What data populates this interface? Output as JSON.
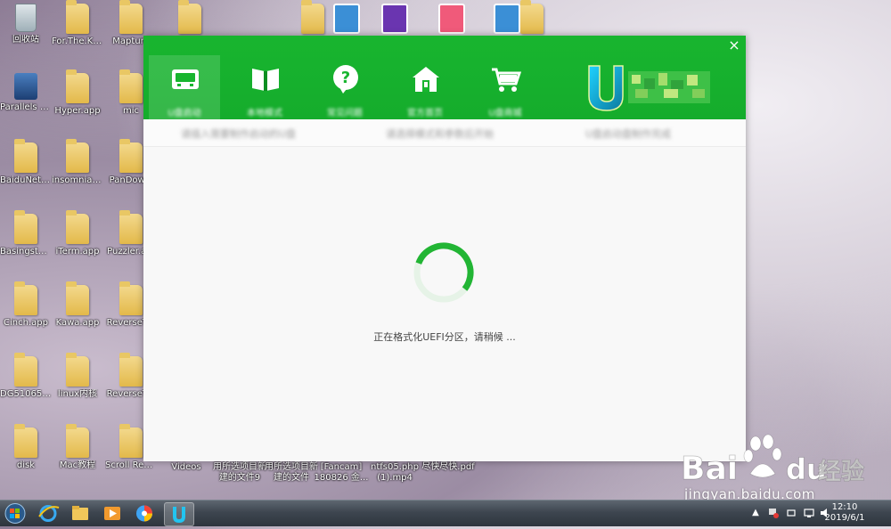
{
  "desktop": {
    "icons": [
      {
        "label": "回收站",
        "kind": "bin"
      },
      {
        "label": "For.The.Ki...",
        "kind": "folder"
      },
      {
        "label": "Mapture",
        "kind": "folder"
      },
      {
        "label": "",
        "kind": "folder"
      },
      {
        "label": "",
        "kind": "folder"
      },
      {
        "label": "",
        "kind": "folder"
      },
      {
        "label": "Parallels Share...",
        "kind": "app"
      },
      {
        "label": "Hyper.app",
        "kind": "folder"
      },
      {
        "label": "mic",
        "kind": "folder"
      },
      {
        "label": "BaiduNetd...",
        "kind": "folder"
      },
      {
        "label": "insomniaxf...",
        "kind": "folder"
      },
      {
        "label": "PanDow...",
        "kind": "folder"
      },
      {
        "label": "Basingstok...",
        "kind": "folder"
      },
      {
        "label": "iTerm.app",
        "kind": "folder"
      },
      {
        "label": "Puzzler.a...",
        "kind": "folder"
      },
      {
        "label": "Cinch.app",
        "kind": "folder"
      },
      {
        "label": "Kawa.app",
        "kind": "folder"
      },
      {
        "label": "ReverseT...",
        "kind": "folder"
      },
      {
        "label": "DG510653...",
        "kind": "folder"
      },
      {
        "label": "linux内核",
        "kind": "folder"
      },
      {
        "label": "ReverseT...",
        "kind": "folder"
      },
      {
        "label": "disk",
        "kind": "folder"
      },
      {
        "label": "Mac教程",
        "kind": "folder"
      },
      {
        "label": "Scroll Reverser....",
        "kind": "folder"
      }
    ],
    "bottom_labels": [
      {
        "label": "Videos",
        "label2": ""
      },
      {
        "label": "用所选项目新",
        "label2": "建的文件9"
      },
      {
        "label": "用所选项目新",
        "label2": "建的文件"
      },
      {
        "label": "[Fancam]",
        "label2": "180826 金..."
      },
      {
        "label": "ntfs05.php",
        "label2": "(1).mp4"
      },
      {
        "label": "尽快尽快.pdf",
        "label2": ""
      }
    ]
  },
  "window": {
    "close_label": "×",
    "nav": [
      {
        "label": "U盘启动",
        "icon": "usb-drive-icon",
        "active": true
      },
      {
        "label": "本地模式",
        "icon": "book-icon",
        "active": false
      },
      {
        "label": "常见问题",
        "icon": "question-bubble-icon",
        "active": false
      },
      {
        "label": "官方首页",
        "icon": "home-icon",
        "active": false
      },
      {
        "label": "U盘商城",
        "icon": "shopping-cart-icon",
        "active": false
      }
    ],
    "logo_text": "U",
    "sub_bar": [
      "请插入需要制作启动的U盘",
      "请选择模式和参数后开始",
      "U盘启动盘制作完成"
    ],
    "status_text": "正在格式化UEFI分区，请稍候 ...",
    "progress": 0.55,
    "colors": {
      "brand_green": "#15ac2c",
      "spinner_track": "#e6f3e7",
      "spinner_arc": "#22b534"
    }
  },
  "taskbar": {
    "time": "12:10",
    "date": "2019/6/1",
    "tray_arrow": "▲"
  },
  "watermark": {
    "brand": "Bai",
    "brand2": "du",
    "cn": "经验",
    "url": "jingyan.baidu.com"
  }
}
